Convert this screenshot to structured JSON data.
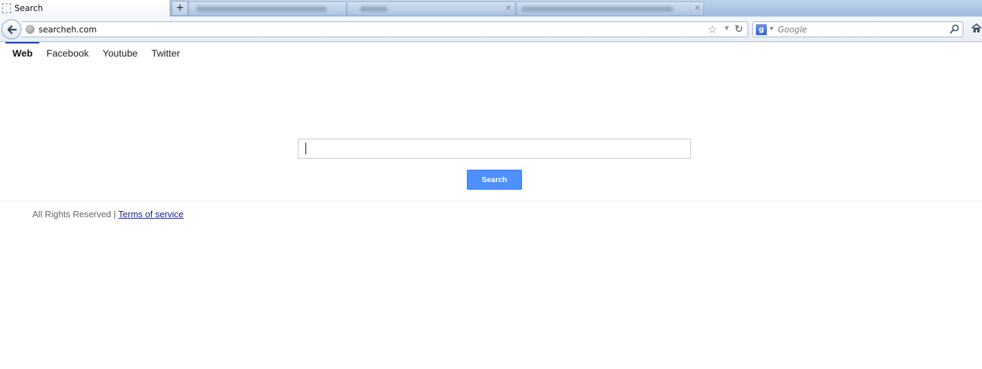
{
  "browser": {
    "active_tab": {
      "title": "Search"
    },
    "new_tab_label": "+",
    "url": "searcheh.com",
    "search_engine": "Google",
    "search_engine_icon": "g"
  },
  "page": {
    "nav": [
      "Web",
      "Facebook",
      "Youtube",
      "Twitter"
    ],
    "active_nav": "Web",
    "search_input_value": "",
    "search_button_label": "Search",
    "footer_text": "All Rights Reserved | ",
    "footer_link": "Terms of service",
    "colors": {
      "accent": "#4d90fe",
      "active_nav_border": "#1a3aa8"
    }
  }
}
